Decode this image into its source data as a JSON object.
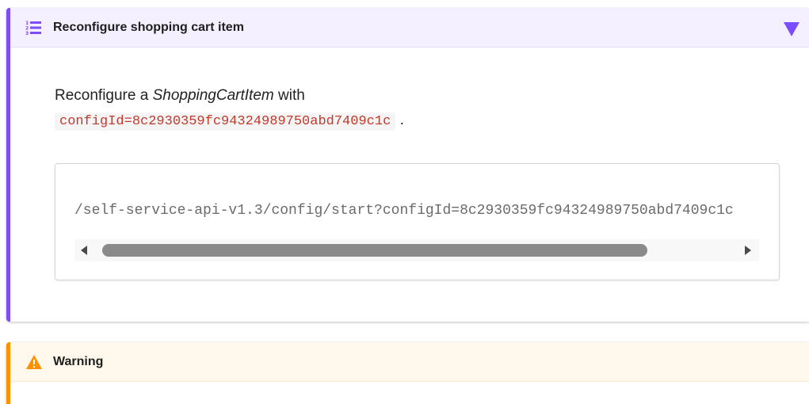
{
  "example": {
    "title": "Reconfigure shopping cart item",
    "icon": "numbered-list-icon",
    "toggle_icon": "triangle-down-icon",
    "accent_color": "#7c4dff",
    "paragraph": {
      "prefix": "Reconfigure a ",
      "emphasis": "ShoppingCartItem",
      "middle": " with",
      "code": "configId=8c2930359fc94324989750abd7409c1c",
      "suffix": "."
    },
    "code_block": {
      "text": "/self-service-api-v1.3/config/start?configId=8c2930359fc94324989750abd7409c1c"
    }
  },
  "warning": {
    "title": "Warning",
    "icon": "warning-triangle-icon",
    "accent_color": "#ff9100"
  }
}
